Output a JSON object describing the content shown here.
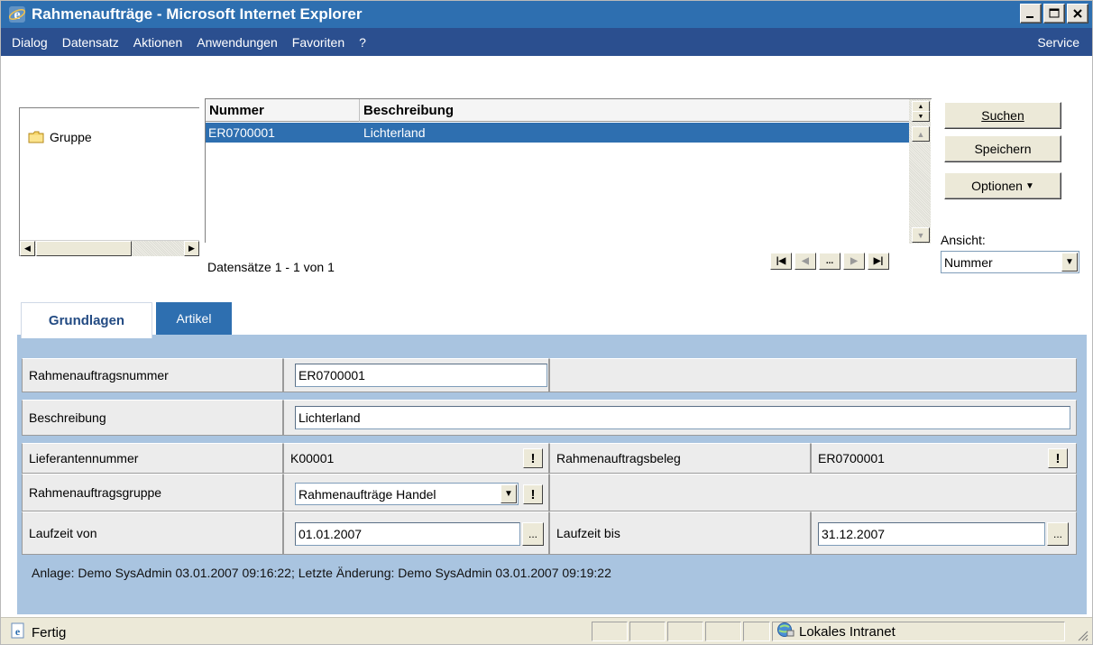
{
  "window": {
    "title": "Rahmenaufträge - Microsoft Internet Explorer",
    "icon": "ie-icon",
    "controls": [
      "minimize",
      "maximize",
      "close"
    ]
  },
  "menu": {
    "items": [
      "Dialog",
      "Datensatz",
      "Aktionen",
      "Anwendungen",
      "Favoriten",
      "?"
    ],
    "service": "Service"
  },
  "tree": {
    "items": [
      {
        "label": "Gruppe",
        "icon": "folder-icon"
      }
    ]
  },
  "grid": {
    "columns": [
      "Nummer",
      "Beschreibung"
    ],
    "rows": [
      {
        "nummer": "ER0700001",
        "beschreibung": "Lichterland",
        "selected": true
      }
    ],
    "records": "Datensätze 1 - 1 von 1",
    "pager_ellipsis": "..."
  },
  "actions": {
    "search": "Suchen",
    "save": "Speichern",
    "options": "Optionen",
    "view_label": "Ansicht:",
    "view_value": "Nummer"
  },
  "tabs": {
    "active": "Grundlagen",
    "inactive": "Artikel"
  },
  "form": {
    "rahmenauftragsnummer_label": "Rahmenauftragsnummer",
    "rahmenauftragsnummer_value": "ER0700001",
    "beschreibung_label": "Beschreibung",
    "beschreibung_value": "Lichterland",
    "lieferantennummer_label": "Lieferantennummer",
    "lieferantennummer_value": "K00001",
    "rahmenauftragsbeleg_label": "Rahmenauftragsbeleg",
    "rahmenauftragsbeleg_value": "ER0700001",
    "rahmenauftragsgruppe_label": "Rahmenauftragsgruppe",
    "rahmenauftragsgruppe_value": "Rahmenaufträge Handel",
    "laufzeit_von_label": "Laufzeit von",
    "laufzeit_von_value": "01.01.2007",
    "laufzeit_bis_label": "Laufzeit bis",
    "laufzeit_bis_value": "31.12.2007",
    "exclamation": "!",
    "ellipsis": "..."
  },
  "audit": "Anlage: Demo SysAdmin 03.01.2007 09:16:22; Letzte Änderung: Demo SysAdmin 03.01.2007 09:19:22",
  "status": {
    "text": "Fertig",
    "zone": "Lokales Intranet"
  },
  "colors": {
    "accent": "#2e6fb0",
    "menubar": "#2b4f8f",
    "panel": "#a9c4e0",
    "tab_text": "#234b83"
  }
}
